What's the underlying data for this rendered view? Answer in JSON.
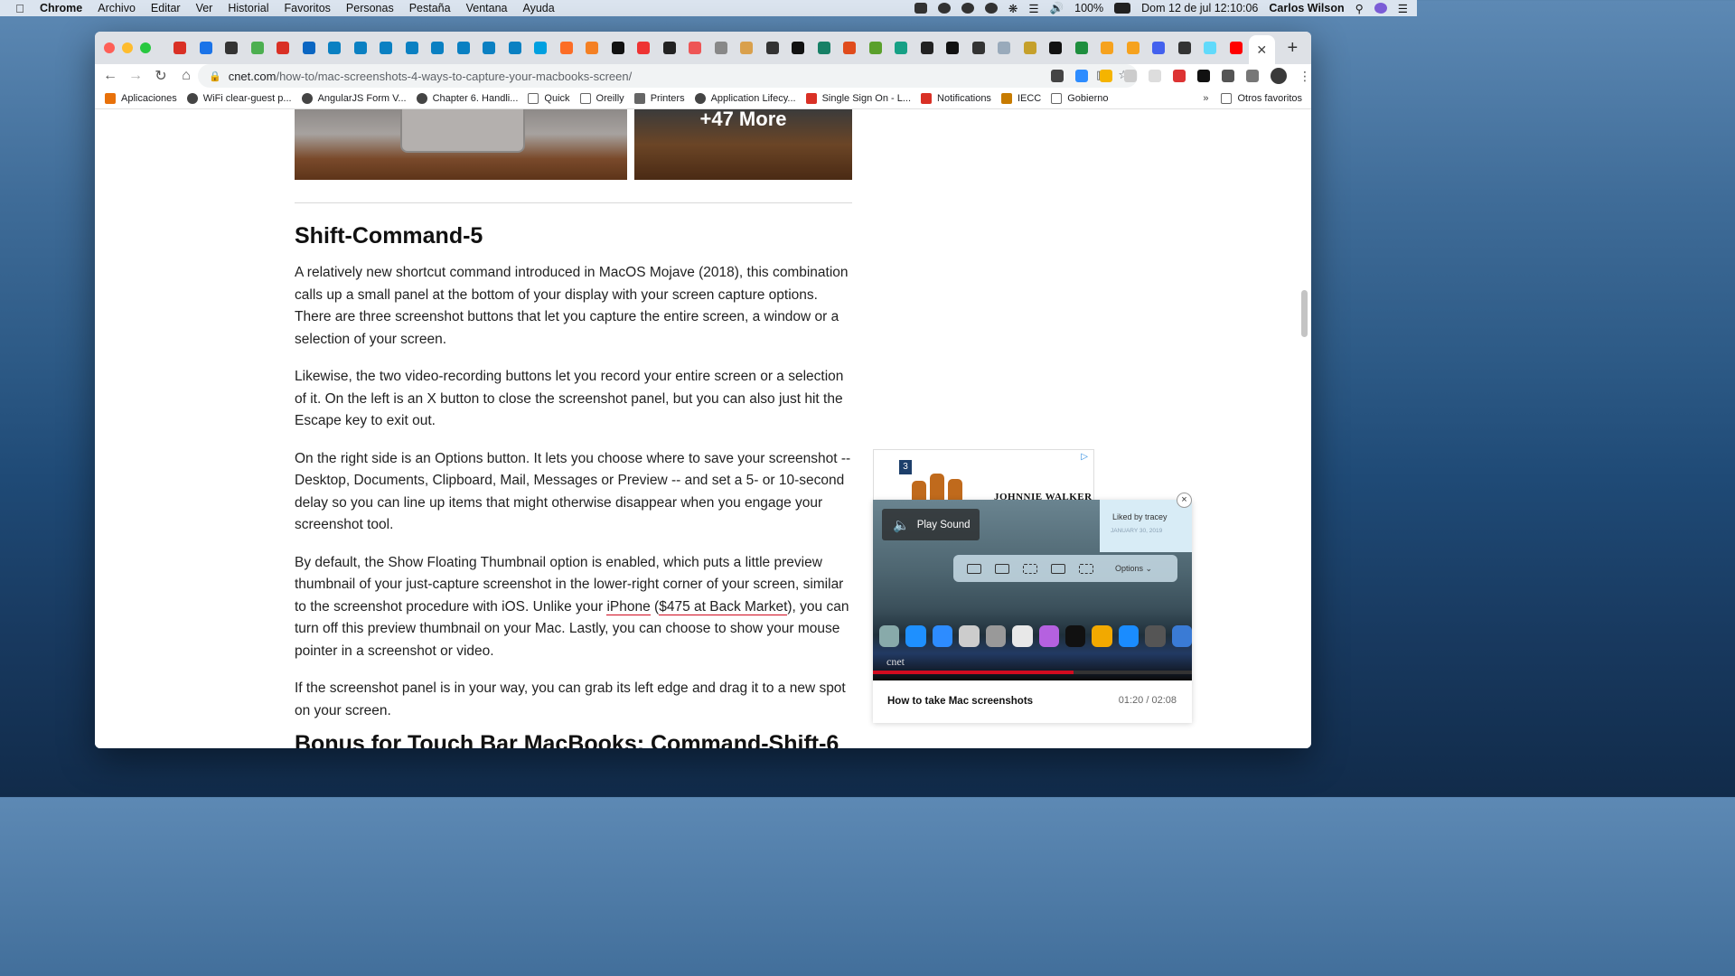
{
  "menubar": {
    "app": "Chrome",
    "items": [
      "Archivo",
      "Editar",
      "Ver",
      "Historial",
      "Favoritos",
      "Personas",
      "Pestaña",
      "Ventana",
      "Ayuda"
    ],
    "battery": "100%",
    "datetime": "Dom 12 de jul  12:10:06",
    "user": "Carlos Wilson"
  },
  "browser": {
    "url_host": "cnet.com",
    "url_path": "/how-to/mac-screenshots-4-ways-to-capture-your-macbooks-screen/",
    "tab_favicons": [
      "gmail-icon",
      "play-icon",
      "circle-icon",
      "leaf-icon",
      "gmail-icon",
      "linkedin-icon",
      "video-icon",
      "video-icon",
      "video-icon",
      "video-icon",
      "video-icon",
      "video-icon",
      "video-icon",
      "video-icon",
      "u-icon",
      "gitlab-icon",
      "stack-icon",
      "m-icon",
      "donut-icon",
      "github-icon",
      "pill-icon",
      "apple-icon",
      "monkey-icon",
      "circle-icon",
      "medium-icon",
      "k-icon",
      "office-icon",
      "microsoft-icon",
      "heart-icon",
      "github-icon",
      "medium-icon",
      "wave-icon",
      "tint-icon",
      "face-icon",
      "medium-icon",
      "sheet-icon",
      "flame-icon",
      "flame-icon",
      "star-icon",
      "circle-icon",
      "react-icon",
      "youtube-icon"
    ],
    "bookmarks": [
      {
        "label": "Aplicaciones",
        "icon": "apps-grid-icon"
      },
      {
        "label": "WiFi clear-guest p...",
        "icon": "globe-icon"
      },
      {
        "label": "AngularJS Form V...",
        "icon": "globe-icon"
      },
      {
        "label": "Chapter 6. Handli...",
        "icon": "globe-icon"
      },
      {
        "label": "Quick",
        "icon": "folder-icon"
      },
      {
        "label": "Oreilly",
        "icon": "folder-icon"
      },
      {
        "label": "Printers",
        "icon": "printer-icon"
      },
      {
        "label": "Application Lifecy...",
        "icon": "globe-icon"
      },
      {
        "label": "Single Sign On - L...",
        "icon": "red-square-icon"
      },
      {
        "label": "Notifications",
        "icon": "red-square-icon"
      },
      {
        "label": "IECC",
        "icon": "iecc-icon"
      },
      {
        "label": "Gobierno",
        "icon": "folder-icon"
      }
    ],
    "bookmarks_overflow": "»",
    "other_bookmarks": "Otros favoritos"
  },
  "article": {
    "image_overlay": "+47 More",
    "heading": "Shift-Command-5",
    "p1": "A relatively new shortcut command introduced in MacOS Mojave (2018), this combination calls up a small panel at the bottom of your display with your screen capture options. There are three screenshot buttons that let you capture the entire screen, a window or a selection of your screen.",
    "p2": "Likewise, the two video-recording buttons let you record your entire screen or a selection of it. On the left is an X button to close the screenshot panel, but you can also just hit the Escape key to exit out.",
    "p3": "On the right side is an Options button. It lets you choose where to save your screenshot -- Desktop, Documents, Clipboard, Mail, Messages or Preview -- and set a 5- or 10-second delay so you can line up items that might otherwise disappear when you engage your screenshot tool.",
    "p4_a": "By default, the Show Floating Thumbnail option is enabled, which puts a little preview thumbnail of your just-capture screenshot in the lower-right corner of your screen, similar to the screenshot procedure with iOS. Unlike your ",
    "p4_link1": "iPhone",
    "p4_b": " (",
    "p4_link2": "$475 at Back Market",
    "p4_c": "), you can turn off this preview thumbnail on your Mac. Lastly, you can choose to show your mouse pointer in a screenshot or video.",
    "p5": "If the screenshot panel is in your way, you can grab its left edge and drag it to a new spot on your screen.",
    "next_heading": "Bonus for Touch Bar MacBooks: Command-Shift-6"
  },
  "ad": {
    "badge": "3",
    "brand": "JOHNNIE WALKER"
  },
  "video": {
    "play_sound": "Play Sound",
    "liked_by": "Liked by tracey",
    "liked_date": "JANUARY 30, 2019",
    "options_label": "Options",
    "watermark": "cnet",
    "title": "How to take Mac screenshots",
    "time": "01:20 / 02:08",
    "progress": 0.63
  }
}
